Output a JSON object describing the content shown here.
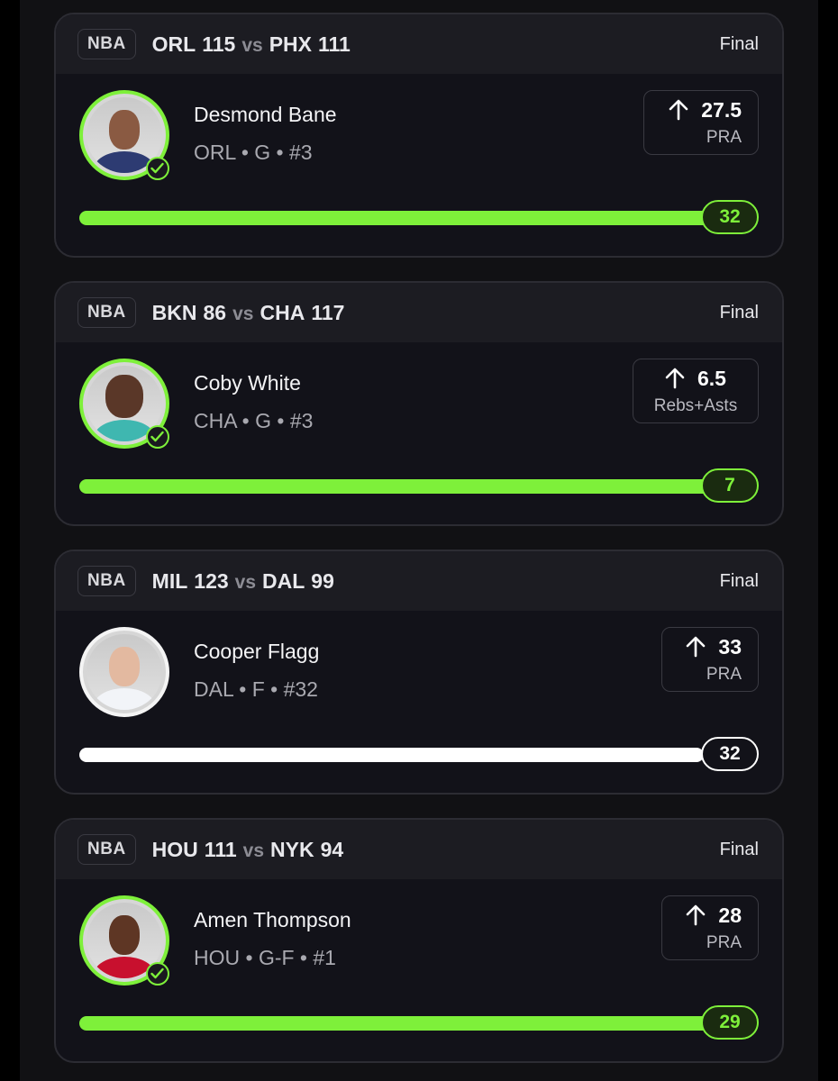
{
  "colors": {
    "hit": "#7ef03a",
    "neutral": "#ffffff",
    "card_bg": "#121219",
    "header_bg": "#1c1c22"
  },
  "picks": [
    {
      "league": "NBA",
      "home_team": "ORL",
      "home_score": "115",
      "vs": "vs",
      "away_team": "PHX",
      "away_score": "111",
      "status": "Final",
      "player_name": "Desmond Bane",
      "player_meta": "ORL • G • #3",
      "direction_icon": "arrow-up-icon",
      "line": "27.5",
      "stat": "PRA",
      "result": "32",
      "progress": 1.0,
      "hit": true
    },
    {
      "league": "NBA",
      "home_team": "BKN",
      "home_score": "86",
      "vs": "vs",
      "away_team": "CHA",
      "away_score": "117",
      "status": "Final",
      "player_name": "Coby White",
      "player_meta": "CHA • G • #3",
      "direction_icon": "arrow-up-icon",
      "line": "6.5",
      "stat": "Rebs+Asts",
      "result": "7",
      "progress": 1.0,
      "hit": true
    },
    {
      "league": "NBA",
      "home_team": "MIL",
      "home_score": "123",
      "vs": "vs",
      "away_team": "DAL",
      "away_score": "99",
      "status": "Final",
      "player_name": "Cooper Flagg",
      "player_meta": "DAL • F • #32",
      "direction_icon": "arrow-up-icon",
      "line": "33",
      "stat": "PRA",
      "result": "32",
      "progress": 0.97,
      "hit": false
    },
    {
      "league": "NBA",
      "home_team": "HOU",
      "home_score": "111",
      "vs": "vs",
      "away_team": "NYK",
      "away_score": "94",
      "status": "Final",
      "player_name": "Amen Thompson",
      "player_meta": "HOU • G-F • #1",
      "direction_icon": "arrow-up-icon",
      "line": "28",
      "stat": "PRA",
      "result": "29",
      "progress": 1.0,
      "hit": true
    }
  ]
}
